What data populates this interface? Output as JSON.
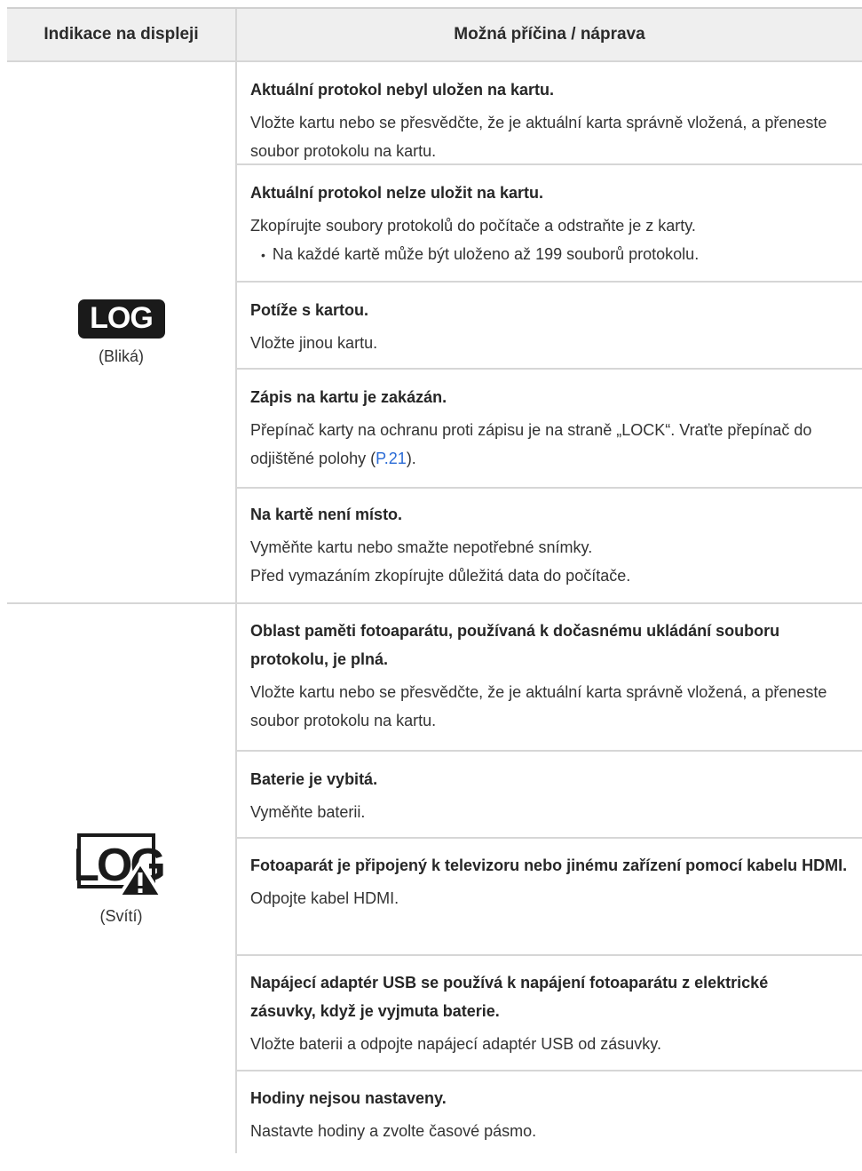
{
  "header": {
    "col1": "Indikace na displeji",
    "col2": "Možná příčina / náprava"
  },
  "groups": [
    {
      "indicator": {
        "icon": "log-badge-icon",
        "label": "LOG",
        "status": "(Bliká)"
      },
      "items": [
        {
          "title": "Aktuální protokol nebyl uložen na kartu.",
          "desc": "Vložte kartu nebo se přesvědčte, že je aktuální karta správně vložená, a přeneste soubor protokolu na kartu."
        },
        {
          "title": "Aktuální protokol nelze uložit na kartu.",
          "desc": "Zkopírujte soubory protokolů do počítače a odstraňte je z karty.",
          "bullet": "Na každé kartě může být uloženo až 199 souborů protokolu."
        },
        {
          "title": "Potíže s kartou.",
          "desc": "Vložte jinou kartu."
        },
        {
          "title": "Zápis na kartu je zakázán.",
          "desc_before": "Přepínač karty na ochranu proti zápisu je na straně „LOCK“. Vraťte přepínač do odjištěné polohy (",
          "link": "P.21",
          "desc_after": ")."
        },
        {
          "title": "Na kartě není místo.",
          "desc": "Vyměňte kartu nebo smažte nepotřebné snímky.",
          "desc2": "Před vymazáním zkopírujte důležitá data do počítače."
        }
      ]
    },
    {
      "indicator": {
        "icon": "log-warning-icon",
        "label": "LOG",
        "status": "(Svítí)"
      },
      "items": [
        {
          "title": "Oblast paměti fotoaparátu, používaná k dočasnému ukládání souboru protokolu, je plná.",
          "desc": "Vložte kartu nebo se přesvědčte, že je aktuální karta správně vložená, a přeneste soubor protokolu na kartu."
        },
        {
          "title": "Baterie je vybitá.",
          "desc": "Vyměňte baterii."
        },
        {
          "title": "Fotoaparát je připojený k televizoru nebo jinému zařízení pomocí kabelu HDMI.",
          "desc": "Odpojte kabel HDMI."
        },
        {
          "title": "Napájecí adaptér USB se používá k napájení fotoaparátu z elektrické zásuvky, když je vyjmuta baterie.",
          "desc": "Vložte baterii a odpojte napájecí adaptér USB od zásuvky."
        },
        {
          "title": "Hodiny nejsou nastaveny.",
          "desc": "Nastavte hodiny a zvolte časové pásmo."
        }
      ]
    }
  ]
}
